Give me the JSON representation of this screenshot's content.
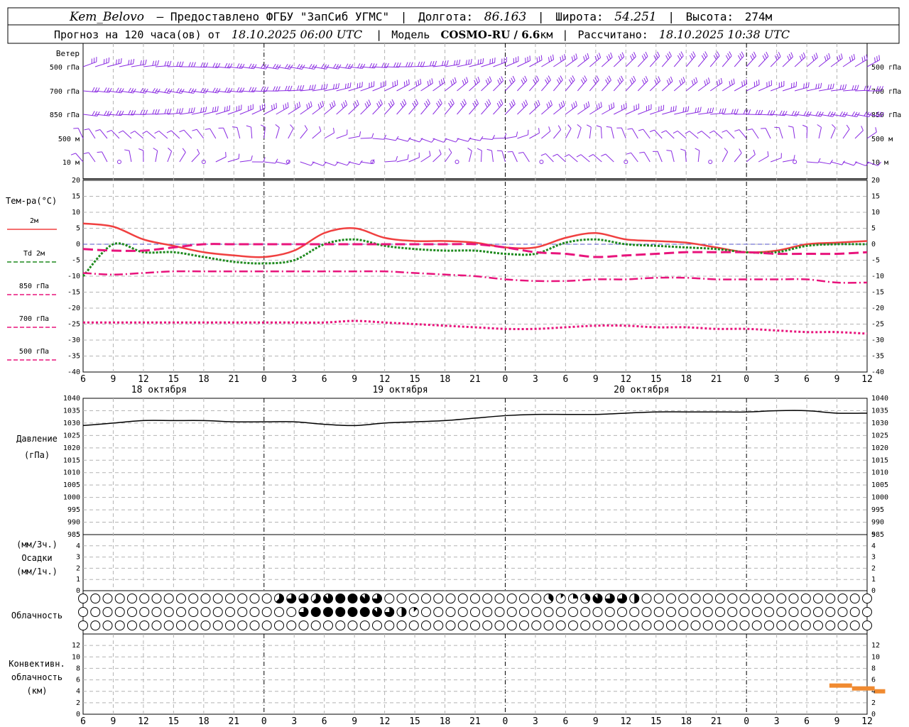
{
  "header": {
    "station": "Kem_Belovo",
    "provider": "– Предоставлено ФГБУ \"ЗапСиб УГМС\"",
    "lon_label": "Долгота:",
    "lon": "86.163",
    "lat_label": "Широта:",
    "lat": "54.251",
    "alt_label": "Высота:",
    "alt": "274м",
    "forecast_prefix": "Прогноз на 120 часа(ов) от",
    "forecast_time": "18.10.2025 06:00 UTC",
    "model_label": "Модель",
    "model": "COSMO-RU / 6.6",
    "model_unit": "км",
    "calc_label": "Рассчитано:",
    "calc_time": "18.10.2025 10:38 UTC"
  },
  "chart_data": {
    "type": "line",
    "x_hours": [
      6,
      9,
      12,
      15,
      18,
      21,
      0,
      3,
      6,
      9,
      12,
      15,
      18,
      21,
      0,
      3,
      6,
      9,
      12,
      15,
      18,
      21,
      0,
      3,
      6,
      9,
      12
    ],
    "x_tick_labels": [
      "6",
      "9",
      "12",
      "15",
      "18",
      "21",
      "0",
      "3",
      "6",
      "9",
      "12",
      "15",
      "18",
      "21",
      "0",
      "3",
      "6",
      "9",
      "12",
      "15",
      "18",
      "21",
      "0",
      "3",
      "6",
      "9",
      "12"
    ],
    "day_labels": [
      "18 октября",
      "19 октября",
      "20 октября"
    ],
    "wind_panel": {
      "title": "Ветер",
      "levels": [
        "500 гПа",
        "700 гПа",
        "850 гПа",
        "500 м",
        "10  м"
      ]
    },
    "temperature_panel": {
      "title": "Тем-ра(°C)",
      "ylim": [
        -40,
        20
      ],
      "yticks": [
        20,
        15,
        10,
        5,
        0,
        -5,
        -10,
        -15,
        -20,
        -25,
        -30,
        -35,
        -40
      ],
      "series": [
        {
          "name": "2м",
          "color": "#f04040",
          "values": [
            6.5,
            5.5,
            1.5,
            -0.5,
            -2.5,
            -3.5,
            -4,
            -2,
            3.5,
            5,
            2,
            1,
            1,
            0.5,
            -1,
            -1,
            2,
            3.5,
            1.5,
            1,
            0.5,
            -1,
            -2.5,
            -2,
            0,
            0.5,
            1
          ]
        },
        {
          "name": "Td 2м",
          "color": "#1e8a1e",
          "values": [
            -10,
            0,
            -2.5,
            -2.5,
            -4,
            -5.5,
            -6,
            -5,
            0,
            1.5,
            -0.5,
            -1.5,
            -2,
            -2,
            -3,
            -3,
            0.5,
            1.5,
            0,
            -0.5,
            -1,
            -1.5,
            -2.5,
            -2.5,
            -0.5,
            0,
            0
          ]
        },
        {
          "name": "850 гПа",
          "color": "#e8147c",
          "values": [
            -1.5,
            -2,
            -2,
            -1,
            0,
            0,
            0,
            0,
            0,
            0,
            0,
            0,
            0,
            0,
            -1,
            -2.5,
            -3,
            -4,
            -3.5,
            -3,
            -2.5,
            -2.5,
            -2.5,
            -3,
            -3,
            -3,
            -2.5
          ]
        },
        {
          "name": "700 гПа",
          "color": "#e8147c",
          "values": [
            -9,
            -9.5,
            -9,
            -8.5,
            -8.5,
            -8.5,
            -8.5,
            -8.5,
            -8.5,
            -8.5,
            -8.5,
            -9,
            -9.5,
            -10,
            -11,
            -11.5,
            -11.5,
            -11,
            -11,
            -10.5,
            -10.5,
            -11,
            -11,
            -11,
            -11,
            -12,
            -12
          ]
        },
        {
          "name": "500 гПа",
          "color": "#e8147c",
          "values": [
            -24.5,
            -24.5,
            -24.5,
            -24.5,
            -24.5,
            -24.5,
            -24.5,
            -24.5,
            -24.5,
            -24,
            -24.5,
            -25,
            -25.5,
            -26,
            -26.5,
            -26.5,
            -26,
            -25.5,
            -25.5,
            -26,
            -26,
            -26.5,
            -26.5,
            -27,
            -27.5,
            -27.5,
            -28
          ]
        }
      ]
    },
    "pressure_panel": {
      "title": "Давление",
      "unit": "(гПа)",
      "ylim": [
        985,
        1040
      ],
      "yticks": [
        1040,
        1035,
        1030,
        1025,
        1020,
        1015,
        1010,
        1005,
        1000,
        995,
        990,
        985
      ],
      "values": [
        1029,
        1030,
        1031,
        1031,
        1031,
        1030.5,
        1030.5,
        1030.5,
        1029.5,
        1029,
        1030,
        1030.5,
        1031,
        1032,
        1033,
        1033.5,
        1033.5,
        1033.5,
        1034,
        1034.5,
        1034.5,
        1034.5,
        1034.5,
        1035,
        1035,
        1034,
        1034
      ]
    },
    "precip_panel": {
      "title": "Осадки",
      "unit_top": "(мм/3ч.)",
      "unit_bottom": "(мм/1ч.)",
      "ylim": [
        0,
        5
      ],
      "yticks": [
        5,
        4,
        3,
        2,
        1,
        0
      ],
      "values": [
        0,
        0,
        0,
        0,
        0,
        0,
        0,
        0,
        0,
        0,
        0,
        0,
        0,
        0,
        0,
        0,
        0,
        0,
        0,
        0,
        0,
        0,
        0,
        0,
        0,
        0,
        0
      ]
    },
    "cloud_panel": {
      "title": "Облачность",
      "rows": [
        [
          0,
          0,
          0,
          0,
          0,
          0,
          0,
          0,
          0,
          0,
          0,
          0,
          0,
          0,
          0,
          0,
          0,
          0,
          0,
          0,
          0,
          0,
          0,
          0,
          0,
          0,
          0,
          0,
          0,
          0,
          0,
          0,
          0,
          0,
          0,
          0,
          0,
          0,
          0,
          0,
          0,
          0,
          0,
          0,
          0,
          0,
          0,
          0,
          4,
          5,
          5,
          5,
          6,
          6,
          6,
          6,
          5,
          6,
          5,
          6,
          7,
          7,
          8,
          8,
          8,
          8,
          8,
          8,
          8,
          7,
          7,
          6,
          6,
          6,
          5,
          4,
          0,
          0,
          0,
          0,
          0,
          0,
          0,
          0,
          0,
          0,
          0,
          0,
          0,
          0,
          0,
          0,
          0,
          0,
          0,
          0,
          0,
          0,
          0,
          0,
          0,
          0,
          0,
          0,
          0,
          0,
          0,
          0,
          0,
          0,
          0,
          0,
          0,
          0,
          0,
          3,
          1,
          2,
          1,
          2,
          3,
          2,
          1,
          2,
          3,
          4,
          6,
          7,
          7,
          6,
          6,
          6,
          5,
          6,
          6,
          5,
          4,
          4,
          0,
          0,
          0,
          0,
          0,
          0,
          0,
          0,
          0,
          0,
          0,
          0,
          0,
          0,
          0,
          0,
          0,
          0,
          0,
          0,
          0,
          0,
          0,
          0,
          0,
          0,
          0,
          0,
          0,
          0,
          0,
          0,
          0,
          0,
          0,
          0,
          0,
          0,
          0,
          0,
          0,
          0,
          0,
          0,
          0,
          0,
          0,
          0,
          0,
          0,
          0,
          0,
          0,
          0,
          0,
          0,
          0
        ],
        [
          0,
          0,
          0,
          0,
          0,
          0,
          0,
          0,
          0,
          0,
          0,
          0,
          0,
          0,
          0,
          0,
          0,
          0,
          0,
          0,
          0,
          0,
          0,
          0,
          0,
          0,
          0,
          0,
          0,
          0,
          0,
          0,
          0,
          0,
          0,
          0,
          0,
          0,
          0,
          0,
          0,
          0,
          0,
          0,
          0,
          0,
          0,
          0,
          0,
          0,
          0,
          0,
          0,
          0,
          4,
          5,
          6,
          4,
          6,
          8,
          8,
          8,
          8,
          8,
          8,
          8,
          8,
          8,
          8,
          8,
          8,
          8,
          8,
          7,
          7,
          6,
          6,
          6,
          5,
          4,
          4,
          3,
          2,
          1,
          1,
          0,
          0,
          0,
          0,
          0,
          0,
          0,
          0,
          0,
          0,
          0,
          0,
          0,
          0,
          0,
          0,
          0,
          0,
          0,
          0,
          0,
          0,
          0,
          0,
          0,
          0,
          0,
          0,
          0,
          0,
          0,
          0,
          0,
          0,
          0,
          0,
          0,
          0,
          0,
          0,
          0,
          0,
          0,
          0,
          0,
          0,
          0,
          0,
          0,
          0,
          0,
          0,
          0,
          0,
          0,
          0,
          0,
          0,
          0,
          0,
          0,
          0,
          0,
          0,
          0,
          0,
          0,
          0,
          0,
          0,
          0,
          0,
          0,
          0,
          0,
          0,
          0,
          0,
          0,
          0,
          0,
          0,
          0,
          0,
          0,
          0,
          0,
          0,
          0,
          0,
          0,
          0,
          0,
          0,
          0,
          0,
          0,
          0,
          0,
          0,
          0,
          0,
          0,
          0,
          0,
          0,
          0,
          0,
          0,
          0,
          0,
          0,
          0,
          0
        ],
        [
          0,
          0,
          0,
          0,
          0,
          0,
          0,
          0,
          0,
          0,
          0,
          0,
          0,
          0,
          0,
          0,
          0,
          0,
          0,
          0,
          0,
          0,
          0,
          0,
          0,
          0,
          0,
          0,
          0,
          0,
          0,
          0,
          0,
          0,
          0,
          0,
          0,
          0,
          0,
          0,
          0,
          0,
          0,
          0,
          0,
          0,
          0,
          0,
          0,
          0,
          0,
          0,
          0,
          0,
          0,
          0,
          0,
          0,
          0,
          0,
          0,
          0,
          0,
          0,
          0,
          0,
          0,
          0,
          0,
          0,
          0,
          0,
          0,
          0,
          0,
          0,
          0,
          0,
          0,
          0,
          0,
          0,
          0,
          0,
          0,
          0,
          0,
          0,
          0,
          0,
          0,
          0,
          0,
          0,
          0,
          0,
          0,
          0,
          0,
          0,
          0,
          0,
          0,
          0,
          0,
          0,
          0,
          0,
          0,
          0,
          0,
          0,
          0,
          0,
          0,
          0,
          0,
          0,
          0,
          0,
          0,
          0,
          0,
          0,
          0,
          0,
          0,
          0,
          0,
          0,
          0,
          0,
          0,
          0,
          0,
          0,
          0,
          0,
          0,
          0,
          0,
          0,
          0,
          0,
          0,
          0,
          0,
          0,
          0,
          0,
          0,
          0,
          0,
          0,
          0,
          0,
          0,
          0,
          0,
          0,
          0,
          0,
          0,
          0,
          0,
          0,
          0,
          0,
          0,
          0,
          0,
          0,
          0,
          0,
          0,
          0,
          0,
          0,
          0,
          0,
          0,
          0,
          0,
          0,
          0,
          0,
          0,
          0,
          0,
          0,
          0,
          0,
          0,
          0,
          0
        ]
      ]
    },
    "convective_panel": {
      "title_line1": "Конвективн.",
      "title_line2": "облачность",
      "unit": "(км)",
      "ylim": [
        0,
        14
      ],
      "yticks": [
        12,
        10,
        8,
        6,
        4,
        2,
        0
      ],
      "segments": [
        {
          "from_hour_index": 24.75,
          "to_hour_index": 25.5,
          "value": 5
        },
        {
          "from_hour_index": 25.5,
          "to_hour_index": 26.25,
          "value": 4.5
        },
        {
          "from_hour_index": 26.25,
          "to_hour_index": 26.6,
          "value": 4
        }
      ]
    },
    "grid": true
  },
  "colors": {
    "wind": "#8a2be2",
    "t2m": "#f04040",
    "td2m": "#1e8a1e",
    "upper": "#e8147c",
    "convective": "#f08a30",
    "cloud_fill": "#000000"
  }
}
